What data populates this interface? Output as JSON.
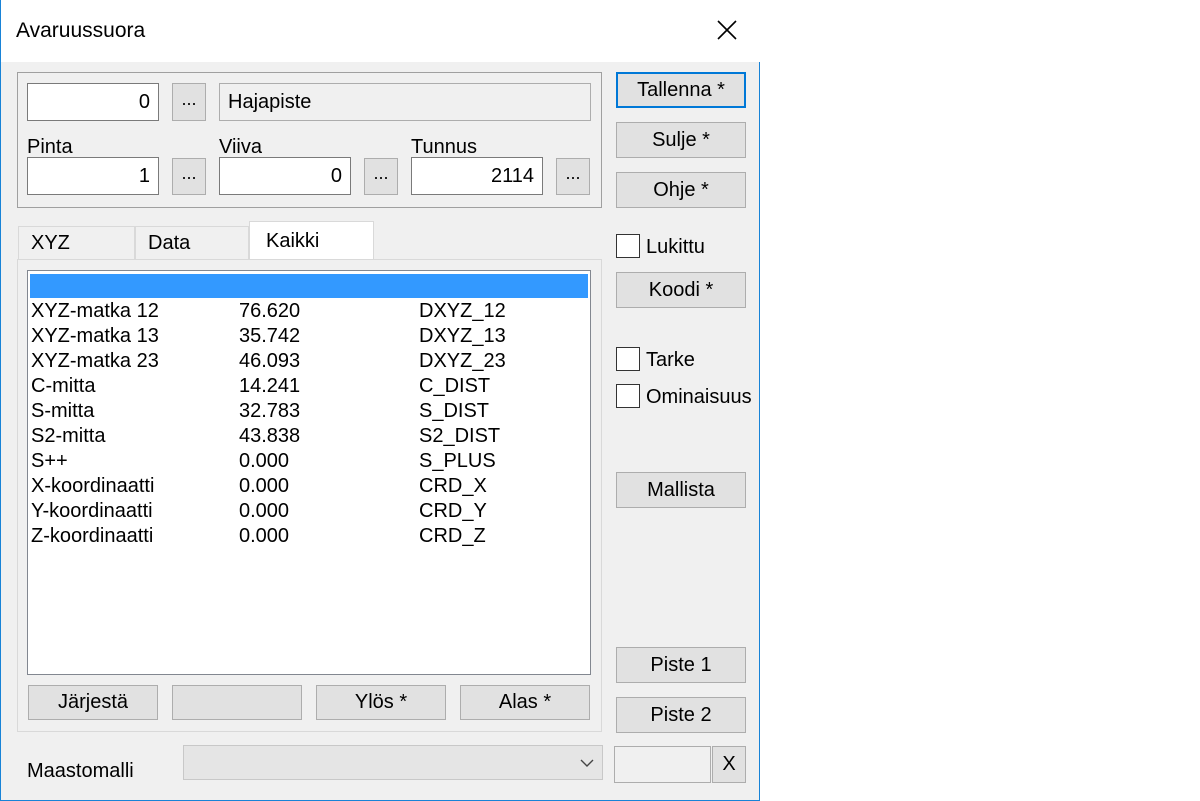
{
  "window": {
    "title": "Avaruussuora",
    "close_label": "✕"
  },
  "top": {
    "point_value": "0",
    "point_type": "Hajapiste",
    "browse_label": "...",
    "pinta_label": "Pinta",
    "pinta_value": "1",
    "viiva_label": "Viiva",
    "viiva_value": "0",
    "tunnus_label": "Tunnus",
    "tunnus_value": "2114"
  },
  "tabs": [
    {
      "label": "XYZ"
    },
    {
      "label": "Data"
    },
    {
      "label": "Kaikki"
    }
  ],
  "list": {
    "rows": [
      {
        "name": "XYZ-matka 12",
        "value": "76.620",
        "code": "DXYZ_12"
      },
      {
        "name": "XYZ-matka 13",
        "value": "35.742",
        "code": "DXYZ_13"
      },
      {
        "name": "XYZ-matka 23",
        "value": "46.093",
        "code": "DXYZ_23"
      },
      {
        "name": "C-mitta",
        "value": "14.241",
        "code": "C_DIST"
      },
      {
        "name": "S-mitta",
        "value": "32.783",
        "code": "S_DIST"
      },
      {
        "name": "S2-mitta",
        "value": "43.838",
        "code": "S2_DIST"
      },
      {
        "name": "S++",
        "value": "0.000",
        "code": "S_PLUS"
      },
      {
        "name": "X-koordinaatti",
        "value": "0.000",
        "code": "CRD_X"
      },
      {
        "name": "Y-koordinaatti",
        "value": "0.000",
        "code": "CRD_Y"
      },
      {
        "name": "Z-koordinaatti",
        "value": "0.000",
        "code": "CRD_Z"
      }
    ]
  },
  "list_buttons": {
    "sort": "Järjestä",
    "blank": "",
    "up": "Ylös *",
    "down": "Alas *"
  },
  "bottom": {
    "maastomalli_label": "Maastomalli",
    "x_label": "X"
  },
  "side": {
    "tallenna": "Tallenna *",
    "sulje": "Sulje *",
    "ohje": "Ohje *",
    "lukittu": "Lukittu",
    "koodi": "Koodi *",
    "tarke": "Tarke",
    "ominaisuus": "Ominaisuus",
    "mallista": "Mallista",
    "piste1": "Piste 1",
    "piste2": "Piste 2"
  },
  "colors": {
    "selection": "#3399ff",
    "accent": "#0078d7"
  }
}
